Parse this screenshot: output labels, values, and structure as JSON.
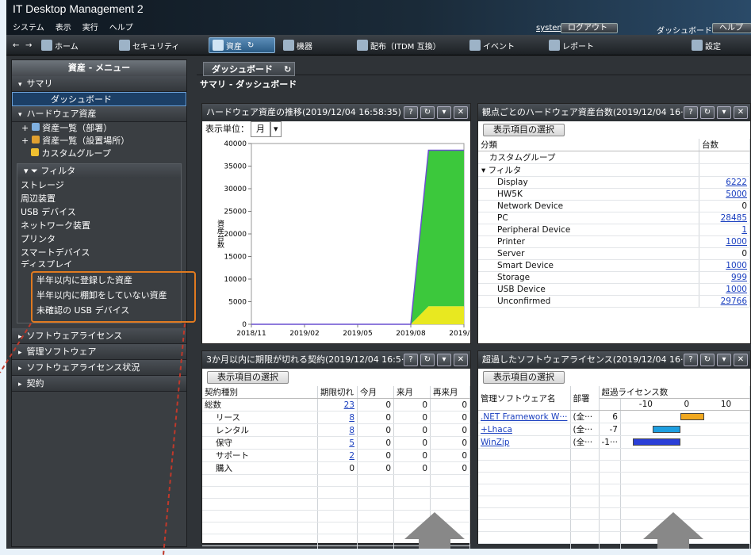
{
  "app": {
    "title": "IT Desktop Management 2"
  },
  "menu": [
    "システム",
    "表示",
    "実行",
    "ヘルプ"
  ],
  "header": {
    "user": "system",
    "logout": "ログアウト",
    "dashboard": "ダッシュボード",
    "help": "ヘルプ"
  },
  "toolbar": {
    "home": "ホーム",
    "security": "セキュリティ",
    "assets": "資産",
    "devices": "機器",
    "distribution": "配布（ITDM 互換）",
    "events": "イベント",
    "reports": "レポート",
    "settings": "設定"
  },
  "sidebar": {
    "title": "資産 - メニュー",
    "summary": "サマリ",
    "dashboard": "ダッシュボード",
    "hardware": "ハードウェア資産",
    "hw_items": [
      "資産一覧（部署）",
      "資産一覧（設置場所）",
      "カスタムグループ"
    ],
    "filter": "フィルタ",
    "filter_items": [
      "ストレージ",
      "周辺装置",
      "USB デバイス",
      "ネットワーク装置",
      "プリンタ",
      "スマートデバイス",
      "ディスプレイ"
    ],
    "highlight_items": [
      "半年以内に登録した資産",
      "半年以内に棚卸をしていない資産",
      "未確認の USB デバイス"
    ],
    "sections": [
      "ソフトウェアライセンス",
      "管理ソフトウェア",
      "ソフトウェアライセンス状況",
      "契約"
    ]
  },
  "main": {
    "tab": "ダッシュボード",
    "breadcrumb": "サマリ - ダッシュボード",
    "select_btn": "表示項目の選択"
  },
  "panel_trend": {
    "title": "ハードウェア資産の推移(2019/12/04 16:58:35)",
    "unit_label": "表示単位：",
    "unit_value": "月",
    "ylabel": "資産台数"
  },
  "panel_hw": {
    "title": "観点ごとのハードウェア資産台数(2019/12/04 16···",
    "col_category": "分類",
    "col_count": "台数",
    "rows": [
      {
        "name": "カスタムグループ",
        "value": "",
        "indent": 1
      },
      {
        "name": "▾ フィルタ",
        "value": "",
        "indent": 0
      },
      {
        "name": "Display",
        "value": "6222",
        "indent": 2,
        "link": true
      },
      {
        "name": "HW5K",
        "value": "5000",
        "indent": 2,
        "link": true
      },
      {
        "name": "Network Device",
        "value": "0",
        "indent": 2
      },
      {
        "name": "PC",
        "value": "28485",
        "indent": 2,
        "link": true
      },
      {
        "name": "Peripheral Device",
        "value": "1",
        "indent": 2,
        "link": true
      },
      {
        "name": "Printer",
        "value": "1000",
        "indent": 2,
        "link": true
      },
      {
        "name": "Server",
        "value": "0",
        "indent": 2
      },
      {
        "name": "Smart Device",
        "value": "1000",
        "indent": 2,
        "link": true
      },
      {
        "name": "Storage",
        "value": "999",
        "indent": 2,
        "link": true
      },
      {
        "name": "USB Device",
        "value": "1000",
        "indent": 2,
        "link": true
      },
      {
        "name": "Unconfirmed",
        "value": "29766",
        "indent": 2,
        "link": true
      }
    ]
  },
  "panel_contract": {
    "title": "3か月以内に期限が切れる契約(2019/12/04 16:5···",
    "cols": [
      "契約種別",
      "期限切れ",
      "今月",
      "来月",
      "再来月"
    ],
    "rows": [
      {
        "name": "総数",
        "vals": [
          "23",
          "0",
          "0",
          "0"
        ],
        "indent": 0
      },
      {
        "name": "リース",
        "vals": [
          "8",
          "0",
          "0",
          "0"
        ],
        "indent": 1
      },
      {
        "name": "レンタル",
        "vals": [
          "8",
          "0",
          "0",
          "0"
        ],
        "indent": 1
      },
      {
        "name": "保守",
        "vals": [
          "5",
          "0",
          "0",
          "0"
        ],
        "indent": 1
      },
      {
        "name": "サポート",
        "vals": [
          "2",
          "0",
          "0",
          "0"
        ],
        "indent": 1
      },
      {
        "name": "購入",
        "vals": [
          "0",
          "0",
          "0",
          "0"
        ],
        "indent": 1
      }
    ]
  },
  "panel_license": {
    "title": "超過したソフトウェアライセンス(2019/12/04 16···",
    "col_name": "管理ソフトウェア名",
    "col_dept": "部署",
    "col_over": "超過ライセンス数",
    "scale": [
      "-10",
      "0",
      "10"
    ],
    "rows": [
      {
        "name": ".NET Framework W···",
        "dept": "(全···",
        "value": "6",
        "num": 6,
        "color": "#f0a820"
      },
      {
        "name": "+Lhaca",
        "dept": "(全···",
        "value": "-7",
        "num": -7,
        "color": "#1e9fe0"
      },
      {
        "name": "WinZip",
        "dept": "(全···",
        "value": "-1···",
        "num": -12,
        "color": "#2a3fd8"
      }
    ]
  },
  "chart_data": {
    "type": "area",
    "title": "ハードウェア資産の推移(2019/12/04 16:58:35)",
    "ylabel": "資産台数",
    "ylim": [
      0,
      40000
    ],
    "yticks": [
      "40000",
      "35000",
      "30000",
      "25000",
      "20000",
      "15000",
      "10000",
      "5000",
      "0"
    ],
    "xticks": [
      "2018/11",
      "2019/02",
      "2019/05",
      "2019/08",
      "2019/11"
    ],
    "x": [
      "2018/11",
      "2018/12",
      "2019/01",
      "2019/02",
      "2019/03",
      "2019/04",
      "2019/05",
      "2019/06",
      "2019/07",
      "2019/08",
      "2019/09",
      "2019/10",
      "2019/11"
    ],
    "series": [
      {
        "color": "#e8e820",
        "values": [
          0,
          0,
          0,
          0,
          0,
          0,
          0,
          0,
          0,
          0,
          4000,
          4000,
          4000
        ]
      },
      {
        "color": "#3cc83c",
        "values": [
          0,
          0,
          0,
          0,
          0,
          0,
          0,
          0,
          0,
          0,
          34500,
          34500,
          34500
        ]
      }
    ],
    "total_line_color": "#6a4fd0"
  }
}
